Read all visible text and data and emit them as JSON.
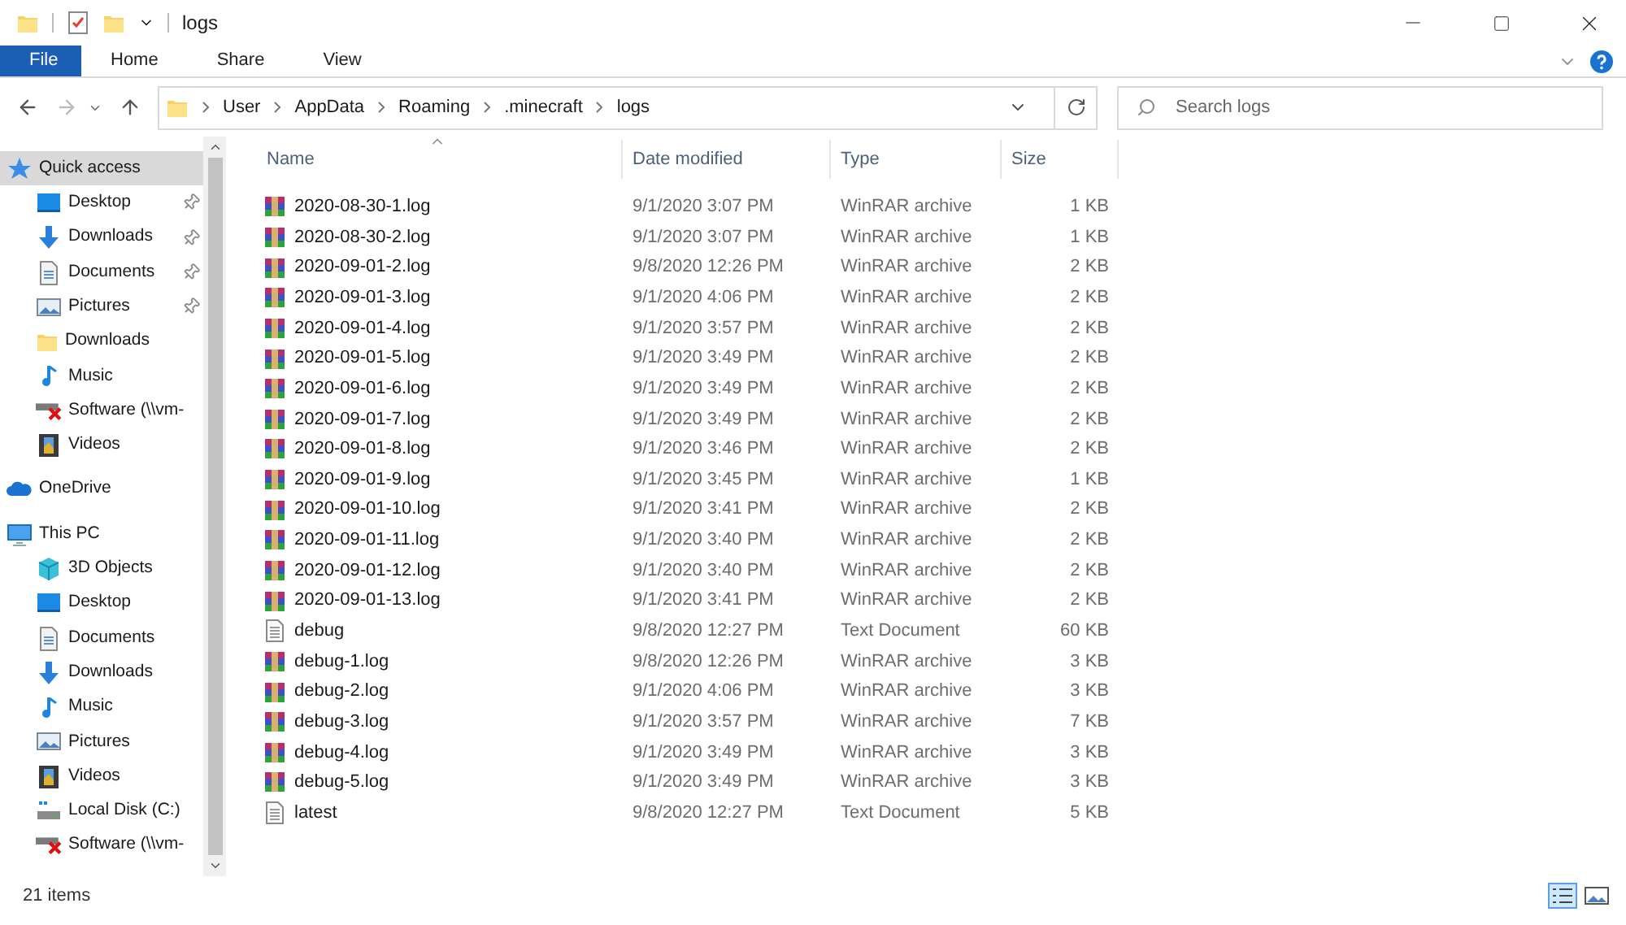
{
  "window": {
    "title": "logs"
  },
  "ribbon_tabs": [
    {
      "label": "File",
      "selected": true
    },
    {
      "label": "Home",
      "selected": false
    },
    {
      "label": "Share",
      "selected": false
    },
    {
      "label": "View",
      "selected": false
    }
  ],
  "breadcrumbs": [
    "User",
    "AppData",
    "Roaming",
    ".minecraft",
    "logs"
  ],
  "search": {
    "placeholder": "Search logs"
  },
  "sidebar": {
    "items": [
      {
        "label": "Quick access",
        "kind": "star",
        "selected": true,
        "children": [
          {
            "label": "Desktop",
            "kind": "desktop",
            "pinned": true
          },
          {
            "label": "Downloads",
            "kind": "downloads",
            "pinned": true
          },
          {
            "label": "Documents",
            "kind": "documents",
            "pinned": true
          },
          {
            "label": "Pictures",
            "kind": "pictures",
            "pinned": true
          },
          {
            "label": "Downloads",
            "kind": "folder",
            "pinned": false
          },
          {
            "label": "Music",
            "kind": "music",
            "pinned": false
          },
          {
            "label": "Software (\\\\vm-",
            "kind": "network",
            "pinned": false
          },
          {
            "label": "Videos",
            "kind": "videos",
            "pinned": false
          }
        ]
      },
      {
        "label": "OneDrive",
        "kind": "cloud",
        "selected": false
      },
      {
        "label": "This PC",
        "kind": "pc",
        "selected": false,
        "children": [
          {
            "label": "3D Objects",
            "kind": "cube"
          },
          {
            "label": "Desktop",
            "kind": "desktop"
          },
          {
            "label": "Documents",
            "kind": "documents"
          },
          {
            "label": "Downloads",
            "kind": "downloads"
          },
          {
            "label": "Music",
            "kind": "music"
          },
          {
            "label": "Pictures",
            "kind": "pictures"
          },
          {
            "label": "Videos",
            "kind": "videos"
          },
          {
            "label": "Local Disk (C:)",
            "kind": "disk"
          },
          {
            "label": "Software (\\\\vm-",
            "kind": "network"
          }
        ]
      }
    ]
  },
  "table": {
    "columns": [
      "Name",
      "Date modified",
      "Type",
      "Size"
    ],
    "rows": [
      {
        "name": "2020-08-30-1.log",
        "date": "9/1/2020 3:07 PM",
        "type": "WinRAR archive",
        "size": "1 KB",
        "kind": "archive"
      },
      {
        "name": "2020-08-30-2.log",
        "date": "9/1/2020 3:07 PM",
        "type": "WinRAR archive",
        "size": "1 KB",
        "kind": "archive"
      },
      {
        "name": "2020-09-01-2.log",
        "date": "9/8/2020 12:26 PM",
        "type": "WinRAR archive",
        "size": "2 KB",
        "kind": "archive"
      },
      {
        "name": "2020-09-01-3.log",
        "date": "9/1/2020 4:06 PM",
        "type": "WinRAR archive",
        "size": "2 KB",
        "kind": "archive"
      },
      {
        "name": "2020-09-01-4.log",
        "date": "9/1/2020 3:57 PM",
        "type": "WinRAR archive",
        "size": "2 KB",
        "kind": "archive"
      },
      {
        "name": "2020-09-01-5.log",
        "date": "9/1/2020 3:49 PM",
        "type": "WinRAR archive",
        "size": "2 KB",
        "kind": "archive"
      },
      {
        "name": "2020-09-01-6.log",
        "date": "9/1/2020 3:49 PM",
        "type": "WinRAR archive",
        "size": "2 KB",
        "kind": "archive"
      },
      {
        "name": "2020-09-01-7.log",
        "date": "9/1/2020 3:49 PM",
        "type": "WinRAR archive",
        "size": "2 KB",
        "kind": "archive"
      },
      {
        "name": "2020-09-01-8.log",
        "date": "9/1/2020 3:46 PM",
        "type": "WinRAR archive",
        "size": "2 KB",
        "kind": "archive"
      },
      {
        "name": "2020-09-01-9.log",
        "date": "9/1/2020 3:45 PM",
        "type": "WinRAR archive",
        "size": "1 KB",
        "kind": "archive"
      },
      {
        "name": "2020-09-01-10.log",
        "date": "9/1/2020 3:41 PM",
        "type": "WinRAR archive",
        "size": "2 KB",
        "kind": "archive"
      },
      {
        "name": "2020-09-01-11.log",
        "date": "9/1/2020 3:40 PM",
        "type": "WinRAR archive",
        "size": "2 KB",
        "kind": "archive"
      },
      {
        "name": "2020-09-01-12.log",
        "date": "9/1/2020 3:40 PM",
        "type": "WinRAR archive",
        "size": "2 KB",
        "kind": "archive"
      },
      {
        "name": "2020-09-01-13.log",
        "date": "9/1/2020 3:41 PM",
        "type": "WinRAR archive",
        "size": "2 KB",
        "kind": "archive"
      },
      {
        "name": "debug",
        "date": "9/8/2020 12:27 PM",
        "type": "Text Document",
        "size": "60 KB",
        "kind": "text"
      },
      {
        "name": "debug-1.log",
        "date": "9/8/2020 12:26 PM",
        "type": "WinRAR archive",
        "size": "3 KB",
        "kind": "archive"
      },
      {
        "name": "debug-2.log",
        "date": "9/1/2020 4:06 PM",
        "type": "WinRAR archive",
        "size": "3 KB",
        "kind": "archive"
      },
      {
        "name": "debug-3.log",
        "date": "9/1/2020 3:57 PM",
        "type": "WinRAR archive",
        "size": "7 KB",
        "kind": "archive"
      },
      {
        "name": "debug-4.log",
        "date": "9/1/2020 3:49 PM",
        "type": "WinRAR archive",
        "size": "3 KB",
        "kind": "archive"
      },
      {
        "name": "debug-5.log",
        "date": "9/1/2020 3:49 PM",
        "type": "WinRAR archive",
        "size": "3 KB",
        "kind": "archive"
      },
      {
        "name": "latest",
        "date": "9/8/2020 12:27 PM",
        "type": "Text Document",
        "size": "5 KB",
        "kind": "text"
      }
    ]
  },
  "status_bar": {
    "count": "21 items"
  }
}
